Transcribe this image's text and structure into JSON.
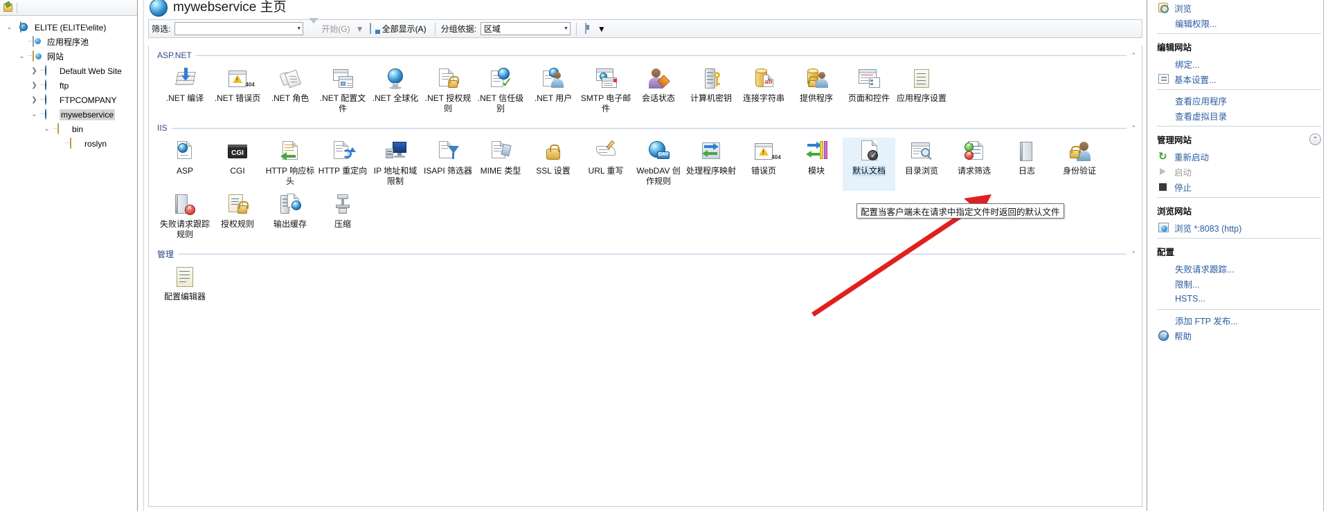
{
  "window": {
    "page_title": "mywebservice 主页"
  },
  "tree": {
    "toolbar_icon": "connections-icon",
    "nodes": [
      {
        "label": "ELITE (ELITE\\elite)",
        "icon": "server-icon",
        "depth": 0,
        "expander": "v",
        "selected": false
      },
      {
        "label": "应用程序池",
        "icon": "app-pools-icon",
        "depth": 1,
        "expander": "",
        "selected": false
      },
      {
        "label": "网站",
        "icon": "sites-folder-icon",
        "depth": 1,
        "expander": "v",
        "selected": false
      },
      {
        "label": "Default Web Site",
        "icon": "site-icon",
        "depth": 2,
        "expander": ">",
        "selected": false
      },
      {
        "label": "ftp",
        "icon": "site-icon",
        "depth": 2,
        "expander": ">",
        "selected": false
      },
      {
        "label": "FTPCOMPANY",
        "icon": "site-icon",
        "depth": 2,
        "expander": ">",
        "selected": false
      },
      {
        "label": "mywebservice",
        "icon": "site-icon",
        "depth": 2,
        "expander": "v",
        "selected": true
      },
      {
        "label": "bin",
        "icon": "folder-icon",
        "depth": 3,
        "expander": "v",
        "selected": false
      },
      {
        "label": "roslyn",
        "icon": "folder-icon",
        "depth": 4,
        "expander": "",
        "selected": false
      }
    ]
  },
  "filter_bar": {
    "filter_label": "筛选:",
    "filter_value": "",
    "filter_placeholder": "",
    "go_label": "开始(G)",
    "show_all_label": "全部显示(A)",
    "group_by_label": "分组依据:",
    "group_by_value": "区域",
    "view_mode_label": ""
  },
  "sections": [
    {
      "title": "ASP.NET",
      "collapse_glyph": "⌃",
      "items": [
        {
          "label": ".NET 编译",
          "icon": "net-compilation-icon"
        },
        {
          "label": ".NET 错误页",
          "icon": "net-error-pages-icon"
        },
        {
          "label": ".NET 角色",
          "icon": "net-roles-icon"
        },
        {
          "label": ".NET 配置文件",
          "icon": "net-profile-icon"
        },
        {
          "label": ".NET 全球化",
          "icon": "net-globalization-icon"
        },
        {
          "label": ".NET 授权规则",
          "icon": "net-authorization-rules-icon"
        },
        {
          "label": ".NET 信任级别",
          "icon": "net-trust-levels-icon"
        },
        {
          "label": ".NET 用户",
          "icon": "net-users-icon"
        },
        {
          "label": "SMTP 电子邮件",
          "icon": "smtp-email-icon"
        },
        {
          "label": "会话状态",
          "icon": "session-state-icon"
        },
        {
          "label": "计算机密钥",
          "icon": "machine-key-icon"
        },
        {
          "label": "连接字符串",
          "icon": "connection-strings-icon"
        },
        {
          "label": "提供程序",
          "icon": "providers-icon"
        },
        {
          "label": "页面和控件",
          "icon": "pages-and-controls-icon"
        },
        {
          "label": "应用程序设置",
          "icon": "application-settings-icon"
        }
      ]
    },
    {
      "title": "IIS",
      "collapse_glyph": "⌃",
      "items": [
        {
          "label": "ASP",
          "icon": "asp-icon"
        },
        {
          "label": "CGI",
          "icon": "cgi-icon"
        },
        {
          "label": "HTTP 响应标头",
          "icon": "http-response-headers-icon"
        },
        {
          "label": "HTTP 重定向",
          "icon": "http-redirect-icon"
        },
        {
          "label": "IP 地址和域限制",
          "icon": "ip-address-domain-restrictions-icon"
        },
        {
          "label": "ISAPI 筛选器",
          "icon": "isapi-filters-icon"
        },
        {
          "label": "MIME 类型",
          "icon": "mime-types-icon"
        },
        {
          "label": "SSL 设置",
          "icon": "ssl-settings-icon"
        },
        {
          "label": "URL 重写",
          "icon": "url-rewrite-icon"
        },
        {
          "label": "WebDAV 创作规则",
          "icon": "webdav-authoring-rules-icon"
        },
        {
          "label": "处理程序映射",
          "icon": "handler-mappings-icon"
        },
        {
          "label": "错误页",
          "icon": "error-pages-icon"
        },
        {
          "label": "模块",
          "icon": "modules-icon"
        },
        {
          "label": "默认文档",
          "icon": "default-document-icon",
          "selected": true
        },
        {
          "label": "目录浏览",
          "icon": "directory-browsing-icon"
        },
        {
          "label": "请求筛选",
          "icon": "request-filtering-icon"
        },
        {
          "label": "日志",
          "icon": "logging-icon"
        },
        {
          "label": "身份验证",
          "icon": "authentication-icon"
        },
        {
          "label": "失败请求跟踪规则",
          "icon": "failed-request-tracing-rules-icon"
        },
        {
          "label": "授权规则",
          "icon": "authorization-rules-icon"
        },
        {
          "label": "输出缓存",
          "icon": "output-caching-icon"
        },
        {
          "label": "压缩",
          "icon": "compression-icon"
        }
      ]
    },
    {
      "title": "管理",
      "collapse_glyph": "⌃",
      "items": [
        {
          "label": "配置编辑器",
          "icon": "configuration-editor-icon"
        }
      ]
    }
  ],
  "tooltip": {
    "text": "配置当客户端未在请求中指定文件时返回的默认文件"
  },
  "actions": {
    "groups": [
      {
        "header": null,
        "items": [
          {
            "label": "浏览",
            "icon": "browse-icon",
            "disabled": false,
            "indent": false
          },
          {
            "label": "编辑权限...",
            "icon": null,
            "disabled": false,
            "indent": true
          }
        ]
      },
      {
        "header": "编辑网站",
        "collapsible": false,
        "items": [
          {
            "label": "绑定...",
            "icon": null,
            "disabled": false,
            "indent": true
          },
          {
            "label": "基本设置...",
            "icon": "settings-icon",
            "disabled": false,
            "indent": false
          }
        ]
      },
      {
        "header": null,
        "items": [
          {
            "label": "查看应用程序",
            "icon": null,
            "disabled": false,
            "indent": true
          },
          {
            "label": "查看虚拟目录",
            "icon": null,
            "disabled": false,
            "indent": true
          }
        ]
      },
      {
        "header": "管理网站",
        "collapsible": true,
        "collapse_glyph": "⌃",
        "items": [
          {
            "label": "重新启动",
            "icon": "restart-icon",
            "disabled": false,
            "indent": false
          },
          {
            "label": "启动",
            "icon": "start-icon",
            "disabled": true,
            "indent": false
          },
          {
            "label": "停止",
            "icon": "stop-icon",
            "disabled": false,
            "indent": false
          }
        ]
      },
      {
        "header": "浏览网站",
        "collapsible": false,
        "items": [
          {
            "label": "浏览 *:8083 (http)",
            "icon": "browse-site-icon",
            "disabled": false,
            "indent": false
          }
        ]
      },
      {
        "header": "配置",
        "collapsible": false,
        "items": [
          {
            "label": "失败请求跟踪...",
            "icon": null,
            "disabled": false,
            "indent": true
          },
          {
            "label": "限制...",
            "icon": null,
            "disabled": false,
            "indent": true
          },
          {
            "label": "HSTS...",
            "icon": null,
            "disabled": false,
            "indent": true
          }
        ]
      },
      {
        "header": null,
        "items": [
          {
            "label": "添加 FTP 发布...",
            "icon": null,
            "disabled": false,
            "indent": true
          },
          {
            "label": "帮助",
            "icon": "help-icon",
            "disabled": false,
            "indent": false
          }
        ]
      }
    ]
  },
  "colors": {
    "link": "#2a5d9e",
    "section_title": "#2b4a8b",
    "selection": "#cde4f7",
    "annotation_arrow": "#e02020"
  }
}
